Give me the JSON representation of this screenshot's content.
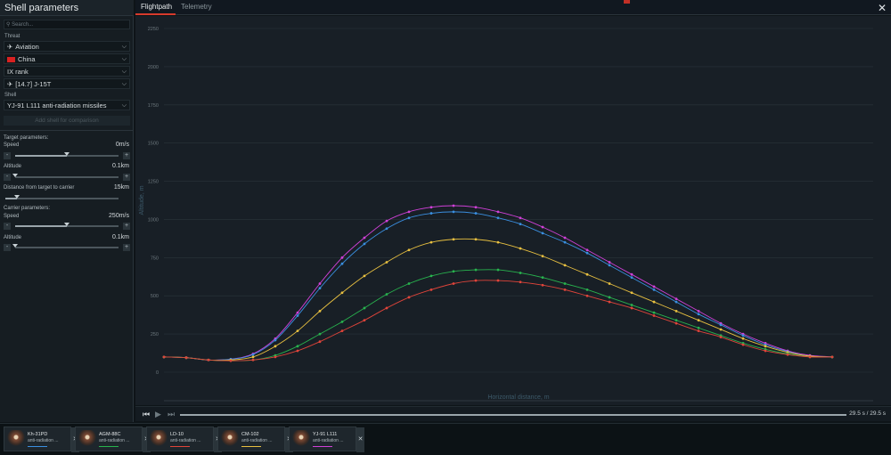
{
  "left_panel": {
    "title": "Shell parameters",
    "search_placeholder": "Search...",
    "threat_label": "Threat",
    "threat_type": "Aviation",
    "country": "China",
    "rank": "IX rank",
    "vehicle": "[14.7] J-15T",
    "shell_label": "Shell",
    "shell": "YJ-91 L111 anti-radiation missiles",
    "add_shell": "Add shell for comparison",
    "target_params_label": "Target parameters:",
    "target_speed_label": "Speed",
    "target_speed_value": "0m/s",
    "target_speed_level": 0.5,
    "target_alt_label": "Altitude",
    "target_alt_value": "0.1km",
    "target_alt_level": 0.0,
    "distance_label": "Distance from target to carrier",
    "distance_value": "15km",
    "distance_level": 0.1,
    "carrier_params_label": "Carrier parameters:",
    "carrier_speed_label": "Speed",
    "carrier_speed_value": "250m/s",
    "carrier_speed_level": 0.5,
    "carrier_alt_label": "Altitude",
    "carrier_alt_value": "0.1km",
    "carrier_alt_level": 0.0,
    "minus": "-",
    "plus": "+"
  },
  "tabs": [
    "Flightpath",
    "Telemetry"
  ],
  "playbar": {
    "time": "29.5 s  /  29.5 s",
    "progress": 1.0
  },
  "cards": [
    {
      "name": "Kh-31PD",
      "sub": "anti-radiation ...",
      "color": "#3a8fe0"
    },
    {
      "name": "AGM-88C",
      "sub": "anti-radiation ...",
      "color": "#28b34e"
    },
    {
      "name": "LD-10",
      "sub": "anti-radiation ...",
      "color": "#e0443a"
    },
    {
      "name": "CM-102",
      "sub": "anti-radiation ...",
      "color": "#e8c040"
    },
    {
      "name": "YJ-91 L111",
      "sub": "anti-radiation ...",
      "color": "#d040d8"
    }
  ],
  "chart_data": {
    "type": "line",
    "xlabel": "Horizontal distance, m",
    "ylabel": "Altitude, m",
    "ylim": [
      0,
      2250
    ],
    "yticks": [
      0,
      250,
      500,
      750,
      1000,
      1250,
      1500,
      1750,
      2000,
      2250
    ],
    "xlim": [
      0,
      15000
    ],
    "grid": true,
    "series": [
      {
        "color": "#d040d8",
        "x": [
          0,
          500,
          1000,
          1500,
          2000,
          2500,
          3000,
          3500,
          4000,
          4500,
          5000,
          5500,
          6000,
          6500,
          7000,
          7500,
          8000,
          8500,
          9000,
          9500,
          10000,
          10500,
          11000,
          11500,
          12000,
          12500,
          13000,
          13500,
          14000,
          14500,
          15000
        ],
        "y": [
          100,
          95,
          80,
          85,
          120,
          220,
          390,
          580,
          750,
          880,
          990,
          1050,
          1080,
          1090,
          1080,
          1050,
          1010,
          950,
          880,
          800,
          720,
          640,
          560,
          480,
          400,
          320,
          250,
          190,
          140,
          110,
          100
        ]
      },
      {
        "color": "#3a8fe0",
        "x": [
          0,
          500,
          1000,
          1500,
          2000,
          2500,
          3000,
          3500,
          4000,
          4500,
          5000,
          5500,
          6000,
          6500,
          7000,
          7500,
          8000,
          8500,
          9000,
          9500,
          10000,
          10500,
          11000,
          11500,
          12000,
          12500,
          13000,
          13500,
          14000,
          14500,
          15000
        ],
        "y": [
          100,
          95,
          80,
          85,
          115,
          210,
          370,
          550,
          710,
          840,
          940,
          1010,
          1040,
          1050,
          1040,
          1010,
          970,
          910,
          850,
          780,
          700,
          620,
          540,
          460,
          380,
          310,
          240,
          180,
          135,
          105,
          100
        ]
      },
      {
        "color": "#e8c040",
        "x": [
          0,
          500,
          1000,
          1500,
          2000,
          2500,
          3000,
          3500,
          4000,
          4500,
          5000,
          5500,
          6000,
          6500,
          7000,
          7500,
          8000,
          8500,
          9000,
          9500,
          10000,
          10500,
          11000,
          11500,
          12000,
          12500,
          13000,
          13500,
          14000,
          14500,
          15000
        ],
        "y": [
          100,
          95,
          80,
          80,
          100,
          170,
          270,
          400,
          520,
          630,
          720,
          800,
          850,
          870,
          870,
          850,
          810,
          760,
          700,
          640,
          580,
          520,
          460,
          400,
          340,
          280,
          220,
          170,
          130,
          105,
          100
        ]
      },
      {
        "color": "#28b34e",
        "x": [
          0,
          500,
          1000,
          1500,
          2000,
          2500,
          3000,
          3500,
          4000,
          4500,
          5000,
          5500,
          6000,
          6500,
          7000,
          7500,
          8000,
          8500,
          9000,
          9500,
          10000,
          10500,
          11000,
          11500,
          12000,
          12500,
          13000,
          13500,
          14000,
          14500,
          15000
        ],
        "y": [
          100,
          95,
          80,
          75,
          80,
          110,
          170,
          250,
          330,
          420,
          510,
          580,
          630,
          660,
          670,
          670,
          650,
          620,
          580,
          540,
          490,
          440,
          390,
          340,
          290,
          240,
          190,
          150,
          120,
          100,
          100
        ]
      },
      {
        "color": "#e0443a",
        "x": [
          0,
          500,
          1000,
          1500,
          2000,
          2500,
          3000,
          3500,
          4000,
          4500,
          5000,
          5500,
          6000,
          6500,
          7000,
          7500,
          8000,
          8500,
          9000,
          9500,
          10000,
          10500,
          11000,
          11500,
          12000,
          12500,
          13000,
          13500,
          14000,
          14500,
          15000
        ],
        "y": [
          100,
          95,
          80,
          75,
          80,
          100,
          140,
          200,
          270,
          340,
          420,
          490,
          540,
          580,
          600,
          600,
          590,
          570,
          540,
          500,
          460,
          420,
          370,
          320,
          270,
          230,
          180,
          140,
          115,
          100,
          100
        ]
      }
    ]
  }
}
